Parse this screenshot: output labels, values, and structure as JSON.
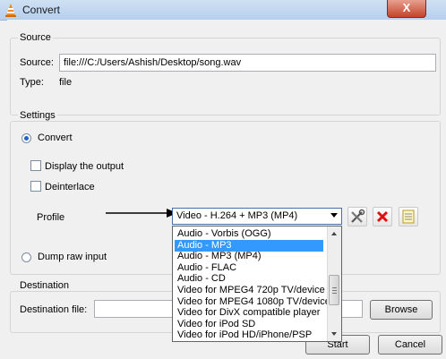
{
  "window": {
    "title": "Convert",
    "close_glyph": "X"
  },
  "source": {
    "group_title": "Source",
    "source_label": "Source:",
    "source_value": "file:///C:/Users/Ashish/Desktop/song.wav",
    "type_label": "Type:",
    "type_value": "file"
  },
  "settings": {
    "group_title": "Settings",
    "convert_label": "Convert",
    "convert_selected": true,
    "display_output_label": "Display the output",
    "display_output_checked": false,
    "deinterlace_label": "Deinterlace",
    "deinterlace_checked": false,
    "profile_label": "Profile",
    "profile_selected": "Video - H.264 + MP3 (MP4)",
    "dump_raw_label": "Dump raw input",
    "dump_raw_selected": false,
    "tools": [
      "edit-profile-icon",
      "delete-profile-icon",
      "new-profile-icon"
    ]
  },
  "profile_options": [
    "Audio - Vorbis (OGG)",
    "Audio - MP3",
    "Audio - MP3 (MP4)",
    "Audio - FLAC",
    "Audio - CD",
    "Video for MPEG4 720p TV/device",
    "Video for MPEG4 1080p TV/device",
    "Video for DivX compatible player",
    "Video for iPod SD",
    "Video for iPod HD/iPhone/PSP"
  ],
  "highlighted_option": "Audio - MP3",
  "destination": {
    "group_title": "Destination",
    "file_label": "Destination file:",
    "file_value": "",
    "browse_label": "Browse"
  },
  "actions": {
    "start_label": "Start",
    "cancel_label": "Cancel"
  },
  "colors": {
    "highlight": "#3399ff",
    "title_bar": "#b6cfee",
    "close": "#c4432b"
  }
}
